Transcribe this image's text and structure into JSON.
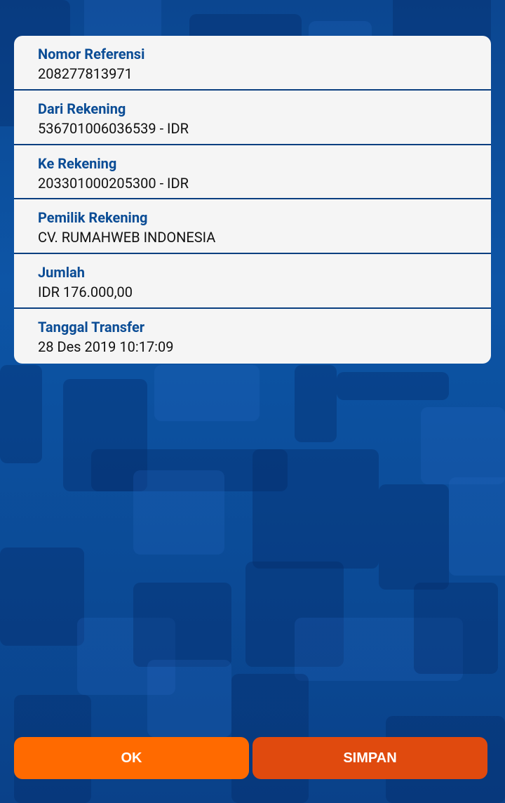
{
  "receipt": {
    "rows": [
      {
        "label": "Nomor Referensi",
        "value": "208277813971"
      },
      {
        "label": "Dari Rekening",
        "value": "536701006036539 - IDR"
      },
      {
        "label": "Ke Rekening",
        "value": "203301000205300 - IDR"
      },
      {
        "label": "Pemilik Rekening",
        "value": "CV. RUMAHWEB INDONESIA"
      },
      {
        "label": "Jumlah",
        "value": "IDR 176.000,00"
      },
      {
        "label": "Tanggal Transfer",
        "value": "28 Des 2019 10:17:09"
      }
    ]
  },
  "actions": {
    "ok_label": "OK",
    "save_label": "SIMPAN"
  },
  "colors": {
    "label": "#0a4c95",
    "ok_button": "#ff6a00",
    "save_button": "#e04a0e",
    "background": "#0a4a96"
  }
}
